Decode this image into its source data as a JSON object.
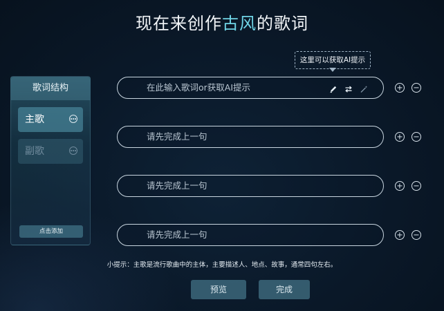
{
  "header": {
    "title_prefix": "现在来创作",
    "title_highlight": "古风",
    "title_suffix": "的歌词"
  },
  "tooltip": {
    "text": "这里可以获取AI提示"
  },
  "sidebar": {
    "title": "歌词结构",
    "items": [
      {
        "label": "主歌",
        "active": true
      },
      {
        "label": "副歌",
        "active": false
      }
    ],
    "add_label": "点击添加"
  },
  "lines": [
    {
      "placeholder": "在此输入歌词or获取AI提示"
    },
    {
      "placeholder": "请先完成上一句"
    },
    {
      "placeholder": "请先完成上一句"
    },
    {
      "placeholder": "请先完成上一句"
    }
  ],
  "hint": {
    "text": "小提示：主歌是流行歌曲中的主体，主要描述人、地点、故事，通常四句左右。"
  },
  "buttons": {
    "preview": "预览",
    "done": "完成"
  },
  "colors": {
    "accent": "#6fd4e6",
    "background": "#0a1828"
  }
}
